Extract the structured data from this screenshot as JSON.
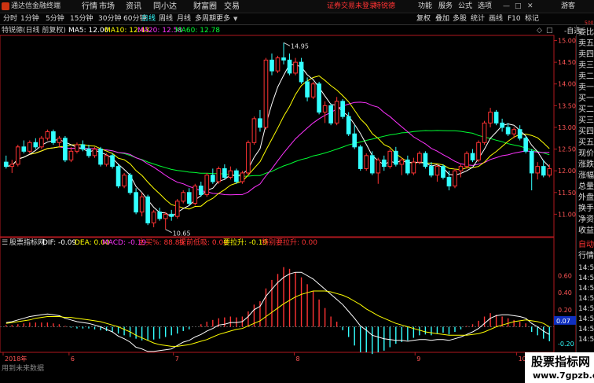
{
  "app": {
    "title": "通达信金融终端",
    "menu": [
      "行情",
      "市场",
      "资讯",
      "同小达",
      "财富圈",
      "交易"
    ],
    "alert": "证券交易未登录",
    "stock_tag": "特锐德",
    "right_menu": [
      "功能",
      "服务",
      "公式",
      "选项"
    ],
    "guest": "游客"
  },
  "tabs": {
    "periods": [
      "分时",
      "1分钟",
      "5分钟",
      "15分钟",
      "30分钟",
      "60分钟",
      "日线",
      "周线",
      "月线",
      "多周期",
      "更多"
    ],
    "active": "日线",
    "tools": [
      "复权",
      "叠加",
      "多股",
      "统计",
      "画线",
      "F10",
      "标记",
      "-自选"
    ]
  },
  "chart": {
    "title": "特锐德(日线 前复权)",
    "ma5": "MA5: 12.00",
    "ma10": "MA10: 12.43",
    "ma20": "MA20: 12.58",
    "ma60": "MA60: 12.78",
    "colors": {
      "ma5": "#ffffff",
      "ma10": "#ffff00",
      "ma20": "#ff33ff",
      "ma60": "#00ff33",
      "up": "#ff3333",
      "down": "#33ffff",
      "axis": "#b0191e"
    },
    "price_labels": [
      "15.00",
      "14.50",
      "14.00",
      "13.50",
      "13.00",
      "12.50",
      "12.00",
      "11.50",
      "11.00"
    ],
    "high_label": "14.95",
    "low_label": "10.65",
    "corner": "500"
  },
  "side": {
    "items": [
      "委比",
      "卖五",
      "卖四",
      "卖三",
      "卖二",
      "卖一",
      "买一",
      "买二",
      "买三",
      "买四",
      "买五",
      "现价",
      "涨跌",
      "涨幅",
      "总量",
      "外盘",
      "换手",
      "净资",
      "收益"
    ],
    "items2": [
      "自动",
      "行情"
    ],
    "times": [
      "14:5",
      "14:5",
      "14:5",
      "14:5",
      "14:5",
      "14:5",
      "14:5",
      "14:5"
    ]
  },
  "macd": {
    "title": "股票指标网",
    "dif": "DIF: -0.09",
    "dea": "DEA: 0.00",
    "macd": "MACD: -0.19",
    "zm": "主买%: 88.89",
    "tq": "提前低吸: 0.00",
    "ml": "要拉升: -0.19",
    "tz": "特别要拉升: 0.00",
    "axis_labels": [
      "0.60",
      "0.40",
      "0.20",
      "-0.20"
    ],
    "cur": "0.07",
    "footer": "用到未来数据"
  },
  "xaxis": {
    "labels": [
      "2018年",
      "6",
      "7",
      "8",
      "9",
      "10"
    ]
  },
  "watermark": {
    "line1": "股票指标网",
    "line2": "www.7gpzb.com"
  },
  "chart_data": {
    "type": "candlestick",
    "ylim": [
      10.5,
      15.1
    ],
    "candles": [
      [
        12.2,
        12.35,
        12.05,
        12.1
      ],
      [
        12.1,
        12.25,
        11.95,
        12.15
      ],
      [
        12.15,
        12.6,
        12.1,
        12.55
      ],
      [
        12.55,
        12.7,
        12.4,
        12.45
      ],
      [
        12.45,
        12.7,
        12.4,
        12.65
      ],
      [
        12.65,
        12.75,
        12.5,
        12.55
      ],
      [
        12.55,
        12.8,
        12.5,
        12.75
      ],
      [
        12.75,
        12.95,
        12.7,
        12.9
      ],
      [
        12.9,
        12.95,
        12.6,
        12.65
      ],
      [
        12.65,
        12.8,
        12.55,
        12.75
      ],
      [
        12.75,
        12.8,
        12.2,
        12.25
      ],
      [
        12.25,
        12.55,
        12.2,
        12.45
      ],
      [
        12.45,
        12.65,
        12.4,
        12.6
      ],
      [
        12.6,
        12.7,
        12.45,
        12.5
      ],
      [
        12.5,
        12.6,
        12.3,
        12.35
      ],
      [
        12.35,
        12.55,
        12.3,
        12.5
      ],
      [
        12.5,
        12.55,
        12.1,
        12.15
      ],
      [
        12.15,
        12.4,
        12.1,
        12.35
      ],
      [
        12.35,
        12.4,
        12.05,
        12.1
      ],
      [
        12.1,
        12.15,
        11.6,
        11.65
      ],
      [
        11.65,
        11.95,
        11.6,
        11.9
      ],
      [
        11.9,
        11.95,
        11.45,
        11.5
      ],
      [
        11.5,
        11.6,
        11.0,
        11.05
      ],
      [
        11.05,
        11.5,
        10.95,
        11.4
      ],
      [
        11.4,
        11.45,
        10.75,
        10.8
      ],
      [
        10.8,
        11.1,
        10.7,
        11.05
      ],
      [
        11.05,
        11.15,
        10.85,
        10.9
      ],
      [
        10.9,
        11.05,
        10.65,
        11.0
      ],
      [
        11.0,
        11.1,
        10.85,
        10.95
      ],
      [
        10.95,
        11.35,
        10.9,
        11.3
      ],
      [
        11.3,
        11.55,
        11.25,
        11.5
      ],
      [
        11.5,
        11.6,
        11.2,
        11.25
      ],
      [
        11.25,
        11.7,
        11.2,
        11.65
      ],
      [
        11.65,
        11.75,
        11.4,
        11.45
      ],
      [
        11.45,
        11.95,
        11.4,
        11.9
      ],
      [
        11.9,
        12.05,
        11.7,
        11.75
      ],
      [
        11.75,
        12.1,
        11.7,
        12.05
      ],
      [
        12.05,
        12.15,
        11.8,
        11.85
      ],
      [
        11.85,
        12.1,
        11.8,
        12.0
      ],
      [
        12.0,
        12.05,
        11.7,
        11.75
      ],
      [
        11.75,
        12.0,
        11.7,
        11.95
      ],
      [
        11.95,
        12.7,
        11.9,
        12.65
      ],
      [
        12.65,
        13.25,
        12.6,
        13.2
      ],
      [
        13.2,
        13.4,
        12.9,
        13.0
      ],
      [
        13.0,
        14.6,
        12.95,
        14.55
      ],
      [
        14.55,
        14.7,
        14.2,
        14.3
      ],
      [
        14.3,
        14.65,
        14.25,
        14.6
      ],
      [
        14.6,
        14.95,
        14.45,
        14.55
      ],
      [
        14.55,
        14.7,
        14.2,
        14.25
      ],
      [
        14.25,
        14.6,
        14.2,
        14.5
      ],
      [
        14.5,
        14.6,
        14.0,
        14.05
      ],
      [
        14.05,
        14.15,
        13.6,
        13.7
      ],
      [
        13.7,
        14.05,
        13.65,
        14.0
      ],
      [
        14.0,
        14.05,
        13.3,
        13.35
      ],
      [
        13.35,
        13.6,
        13.1,
        13.5
      ],
      [
        13.5,
        13.55,
        13.05,
        13.1
      ],
      [
        13.1,
        13.7,
        13.05,
        13.6
      ],
      [
        13.6,
        13.65,
        13.2,
        13.25
      ],
      [
        13.25,
        13.35,
        12.8,
        12.85
      ],
      [
        12.85,
        13.05,
        12.5,
        12.55
      ],
      [
        12.55,
        12.6,
        12.0,
        12.05
      ],
      [
        12.05,
        12.4,
        12.0,
        12.35
      ],
      [
        12.35,
        12.45,
        11.9,
        11.95
      ],
      [
        11.95,
        12.3,
        11.7,
        12.25
      ],
      [
        12.25,
        12.35,
        12.0,
        12.1
      ],
      [
        12.1,
        12.5,
        12.05,
        12.45
      ],
      [
        12.45,
        12.55,
        12.1,
        12.15
      ],
      [
        12.15,
        12.3,
        11.9,
        12.25
      ],
      [
        12.25,
        12.35,
        11.9,
        11.95
      ],
      [
        11.95,
        12.3,
        11.9,
        12.2
      ],
      [
        12.2,
        12.45,
        12.15,
        12.4
      ],
      [
        12.4,
        12.45,
        12.05,
        12.1
      ],
      [
        12.1,
        12.2,
        11.85,
        11.9
      ],
      [
        11.9,
        12.15,
        11.75,
        12.1
      ],
      [
        12.1,
        12.15,
        11.8,
        11.85
      ],
      [
        11.85,
        12.0,
        11.55,
        11.65
      ],
      [
        11.65,
        12.05,
        11.6,
        12.0
      ],
      [
        12.0,
        12.15,
        11.85,
        12.1
      ],
      [
        12.1,
        12.45,
        12.05,
        12.4
      ],
      [
        12.4,
        12.5,
        12.2,
        12.25
      ],
      [
        12.25,
        12.7,
        12.2,
        12.65
      ],
      [
        12.65,
        13.15,
        12.6,
        13.1
      ],
      [
        13.1,
        13.45,
        13.0,
        13.35
      ],
      [
        13.35,
        13.4,
        13.05,
        13.1
      ],
      [
        13.1,
        13.2,
        12.9,
        13.0
      ],
      [
        13.0,
        13.1,
        12.8,
        12.85
      ],
      [
        12.85,
        13.0,
        12.75,
        12.95
      ],
      [
        12.95,
        13.05,
        12.7,
        12.75
      ],
      [
        12.75,
        12.8,
        12.4,
        12.45
      ],
      [
        12.45,
        12.5,
        11.55,
        11.95
      ],
      [
        11.95,
        12.2,
        11.8,
        12.1
      ],
      [
        12.1,
        12.25,
        11.85,
        11.9
      ],
      [
        11.9,
        12.15,
        11.85,
        12.05
      ]
    ],
    "macd_ylim": [
      -0.3,
      0.9
    ],
    "macd_hist": [
      0.02,
      0.02,
      0.03,
      0.04,
      0.05,
      0.05,
      0.05,
      0.05,
      0.04,
      0.03,
      0.01,
      -0.01,
      -0.02,
      -0.02,
      -0.02,
      -0.03,
      -0.04,
      -0.05,
      -0.06,
      -0.08,
      -0.1,
      -0.12,
      -0.14,
      -0.16,
      -0.16,
      -0.15,
      -0.14,
      -0.12,
      -0.1,
      -0.08,
      -0.05,
      -0.03,
      0.0,
      0.03,
      0.06,
      0.08,
      0.1,
      0.11,
      0.12,
      0.11,
      0.12,
      0.18,
      0.26,
      0.3,
      0.45,
      0.55,
      0.62,
      0.7,
      0.68,
      0.64,
      0.58,
      0.5,
      0.42,
      0.32,
      0.22,
      0.12,
      0.06,
      -0.04,
      -0.12,
      -0.22,
      -0.3,
      -0.3,
      -0.32,
      -0.3,
      -0.28,
      -0.24,
      -0.2,
      -0.18,
      -0.16,
      -0.13,
      -0.1,
      -0.09,
      -0.1,
      -0.08,
      -0.07,
      -0.09,
      -0.06,
      -0.03,
      0.01,
      0.03,
      0.07,
      0.12,
      0.16,
      0.14,
      0.12,
      0.1,
      0.08,
      0.06,
      0.04,
      -0.06,
      -0.1,
      -0.14,
      -0.17
    ],
    "dif": [
      0.05,
      0.06,
      0.08,
      0.1,
      0.12,
      0.13,
      0.14,
      0.15,
      0.14,
      0.13,
      0.1,
      0.08,
      0.06,
      0.05,
      0.04,
      0.02,
      0.0,
      -0.03,
      -0.06,
      -0.11,
      -0.14,
      -0.18,
      -0.24,
      -0.26,
      -0.29,
      -0.29,
      -0.28,
      -0.27,
      -0.26,
      -0.22,
      -0.18,
      -0.16,
      -0.12,
      -0.09,
      -0.05,
      -0.02,
      0.02,
      0.03,
      0.05,
      0.05,
      0.06,
      0.12,
      0.2,
      0.24,
      0.36,
      0.44,
      0.52,
      0.58,
      0.62,
      0.64,
      0.64,
      0.6,
      0.56,
      0.5,
      0.44,
      0.38,
      0.32,
      0.26,
      0.18,
      0.1,
      0.01,
      -0.04,
      -0.1,
      -0.12,
      -0.14,
      -0.15,
      -0.16,
      -0.16,
      -0.17,
      -0.16,
      -0.15,
      -0.15,
      -0.16,
      -0.15,
      -0.15,
      -0.16,
      -0.14,
      -0.12,
      -0.09,
      -0.06,
      -0.02,
      0.04,
      0.1,
      0.13,
      0.14,
      0.14,
      0.13,
      0.12,
      0.1,
      0.04,
      0.0,
      -0.05,
      -0.09
    ],
    "dea": [
      0.04,
      0.05,
      0.06,
      0.07,
      0.08,
      0.1,
      0.11,
      0.12,
      0.12,
      0.12,
      0.11,
      0.11,
      0.1,
      0.09,
      0.08,
      0.07,
      0.06,
      0.04,
      0.02,
      0.0,
      -0.03,
      -0.06,
      -0.1,
      -0.13,
      -0.16,
      -0.19,
      -0.21,
      -0.22,
      -0.23,
      -0.23,
      -0.22,
      -0.21,
      -0.19,
      -0.17,
      -0.15,
      -0.12,
      -0.09,
      -0.07,
      -0.05,
      -0.03,
      -0.02,
      0.01,
      0.04,
      0.07,
      0.12,
      0.17,
      0.22,
      0.27,
      0.31,
      0.35,
      0.38,
      0.4,
      0.42,
      0.42,
      0.42,
      0.41,
      0.39,
      0.37,
      0.34,
      0.3,
      0.26,
      0.21,
      0.17,
      0.13,
      0.1,
      0.07,
      0.04,
      0.02,
      0.0,
      -0.02,
      -0.04,
      -0.06,
      -0.07,
      -0.08,
      -0.09,
      -0.1,
      -0.1,
      -0.1,
      -0.1,
      -0.09,
      -0.08,
      -0.06,
      -0.03,
      0.0,
      0.02,
      0.04,
      0.06,
      0.07,
      0.08,
      0.07,
      0.06,
      0.04,
      0.0
    ]
  }
}
